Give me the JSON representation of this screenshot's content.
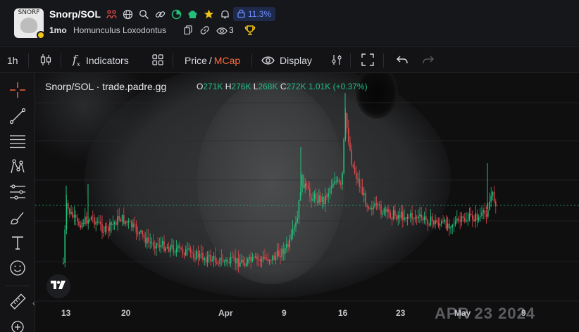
{
  "header": {
    "logo_text": "SNORF",
    "pair": "Snorp/SOL",
    "lock_percent": "11.3%",
    "age": "1mo",
    "token_name": "Homunculus Loxodontus",
    "viewers": "3",
    "icons": [
      "people-icon",
      "globe-icon",
      "search-icon",
      "link-icon",
      "pie-icon",
      "chef-hat-icon",
      "star-icon",
      "bell-icon",
      "lock-icon"
    ]
  },
  "toolbar": {
    "interval": "1h",
    "indicators_label": "Indicators",
    "price_label": "Price",
    "slash": "/",
    "mcap_label": "MCap",
    "display_label": "Display"
  },
  "chart": {
    "title": "Snorp/SOL · trade.padre.gg",
    "ohlc": {
      "o_key": "O",
      "o_val": "271K",
      "h_key": "H",
      "h_val": "276K",
      "l_key": "L",
      "l_val": "268K",
      "c_key": "C",
      "c_val": "272K",
      "change": "1.01K (+0.37%)"
    },
    "x_labels": [
      "13",
      "20",
      "Apr",
      "9",
      "16",
      "23",
      "May",
      "9"
    ],
    "watermark": "APR 23  2024",
    "colors": {
      "up": "#22c17a",
      "down": "#e0474c",
      "mcap": "#ff6a3d",
      "accent": "#f2c417"
    }
  },
  "chart_data": {
    "type": "candlestick",
    "title": "Snorp/SOL · trade.padre.gg",
    "x_ticks": [
      "13",
      "20",
      "Apr",
      "9",
      "16",
      "23",
      "May",
      "9"
    ],
    "last_candle": {
      "open": "271K",
      "high": "276K",
      "low": "268K",
      "close": "272K",
      "change": "1.01K (+0.37%)"
    },
    "grid": true
  }
}
